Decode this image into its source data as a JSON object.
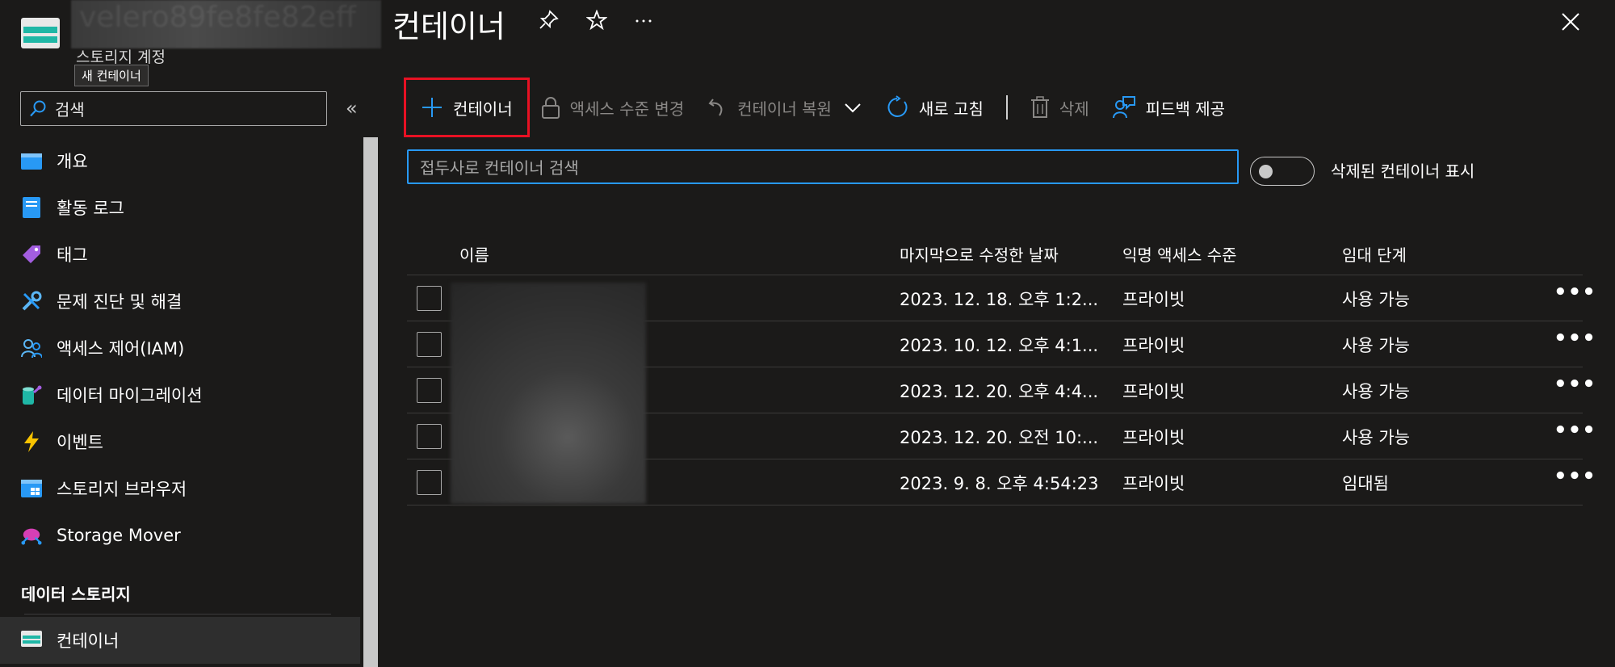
{
  "header": {
    "resource_name": "velero89fe8fe82eff",
    "resource_type": "스토리지 계정",
    "tooltip": "새 컨테이너",
    "page_title": "컨테이너"
  },
  "sidebar": {
    "search_label": "검색",
    "items": [
      {
        "label": "개요",
        "icon": "overview-icon"
      },
      {
        "label": "활동 로그",
        "icon": "activity-log-icon"
      },
      {
        "label": "태그",
        "icon": "tag-icon"
      },
      {
        "label": "문제 진단 및 해결",
        "icon": "wrench-icon"
      },
      {
        "label": "액세스 제어(IAM)",
        "icon": "people-icon"
      },
      {
        "label": "데이터 마이그레이션",
        "icon": "migration-icon"
      },
      {
        "label": "이벤트",
        "icon": "lightning-icon"
      },
      {
        "label": "스토리지 브라우저",
        "icon": "storage-browser-icon"
      },
      {
        "label": "Storage Mover",
        "icon": "storage-mover-icon"
      }
    ],
    "section_title": "데이터 스토리지",
    "active_item": "컨테이너"
  },
  "toolbar": {
    "add_container": "컨테이너",
    "change_access": "액세스 수준 변경",
    "restore_container": "컨테이너 복원",
    "refresh": "새로 고침",
    "delete": "삭제",
    "feedback": "피드백 제공"
  },
  "filter": {
    "placeholder": "접두사로 컨테이너 검색",
    "show_deleted_label": "삭제된 컨테이너 표시"
  },
  "table": {
    "columns": [
      "이름",
      "마지막으로 수정한 날짜",
      "익명 액세스 수준",
      "임대 단계"
    ],
    "rows": [
      {
        "modified": "2023. 12. 18. 오후 1:2...",
        "access": "프라이빗",
        "lease": "사용 가능"
      },
      {
        "modified": "2023. 10. 12. 오후 4:1...",
        "access": "프라이빗",
        "lease": "사용 가능"
      },
      {
        "modified": "2023. 12. 20. 오후 4:4...",
        "access": "프라이빗",
        "lease": "사용 가능"
      },
      {
        "modified": "2023. 12. 20. 오전 10:...",
        "access": "프라이빗",
        "lease": "사용 가능"
      },
      {
        "modified": "2023. 9. 8. 오후 4:54:23",
        "access": "프라이빗",
        "lease": "임대됨"
      }
    ],
    "more_label": "•••"
  },
  "colors": {
    "background": "#1b1a19",
    "accent": "#2899f5",
    "highlight": "#e81123",
    "disabled": "#8a8886"
  }
}
